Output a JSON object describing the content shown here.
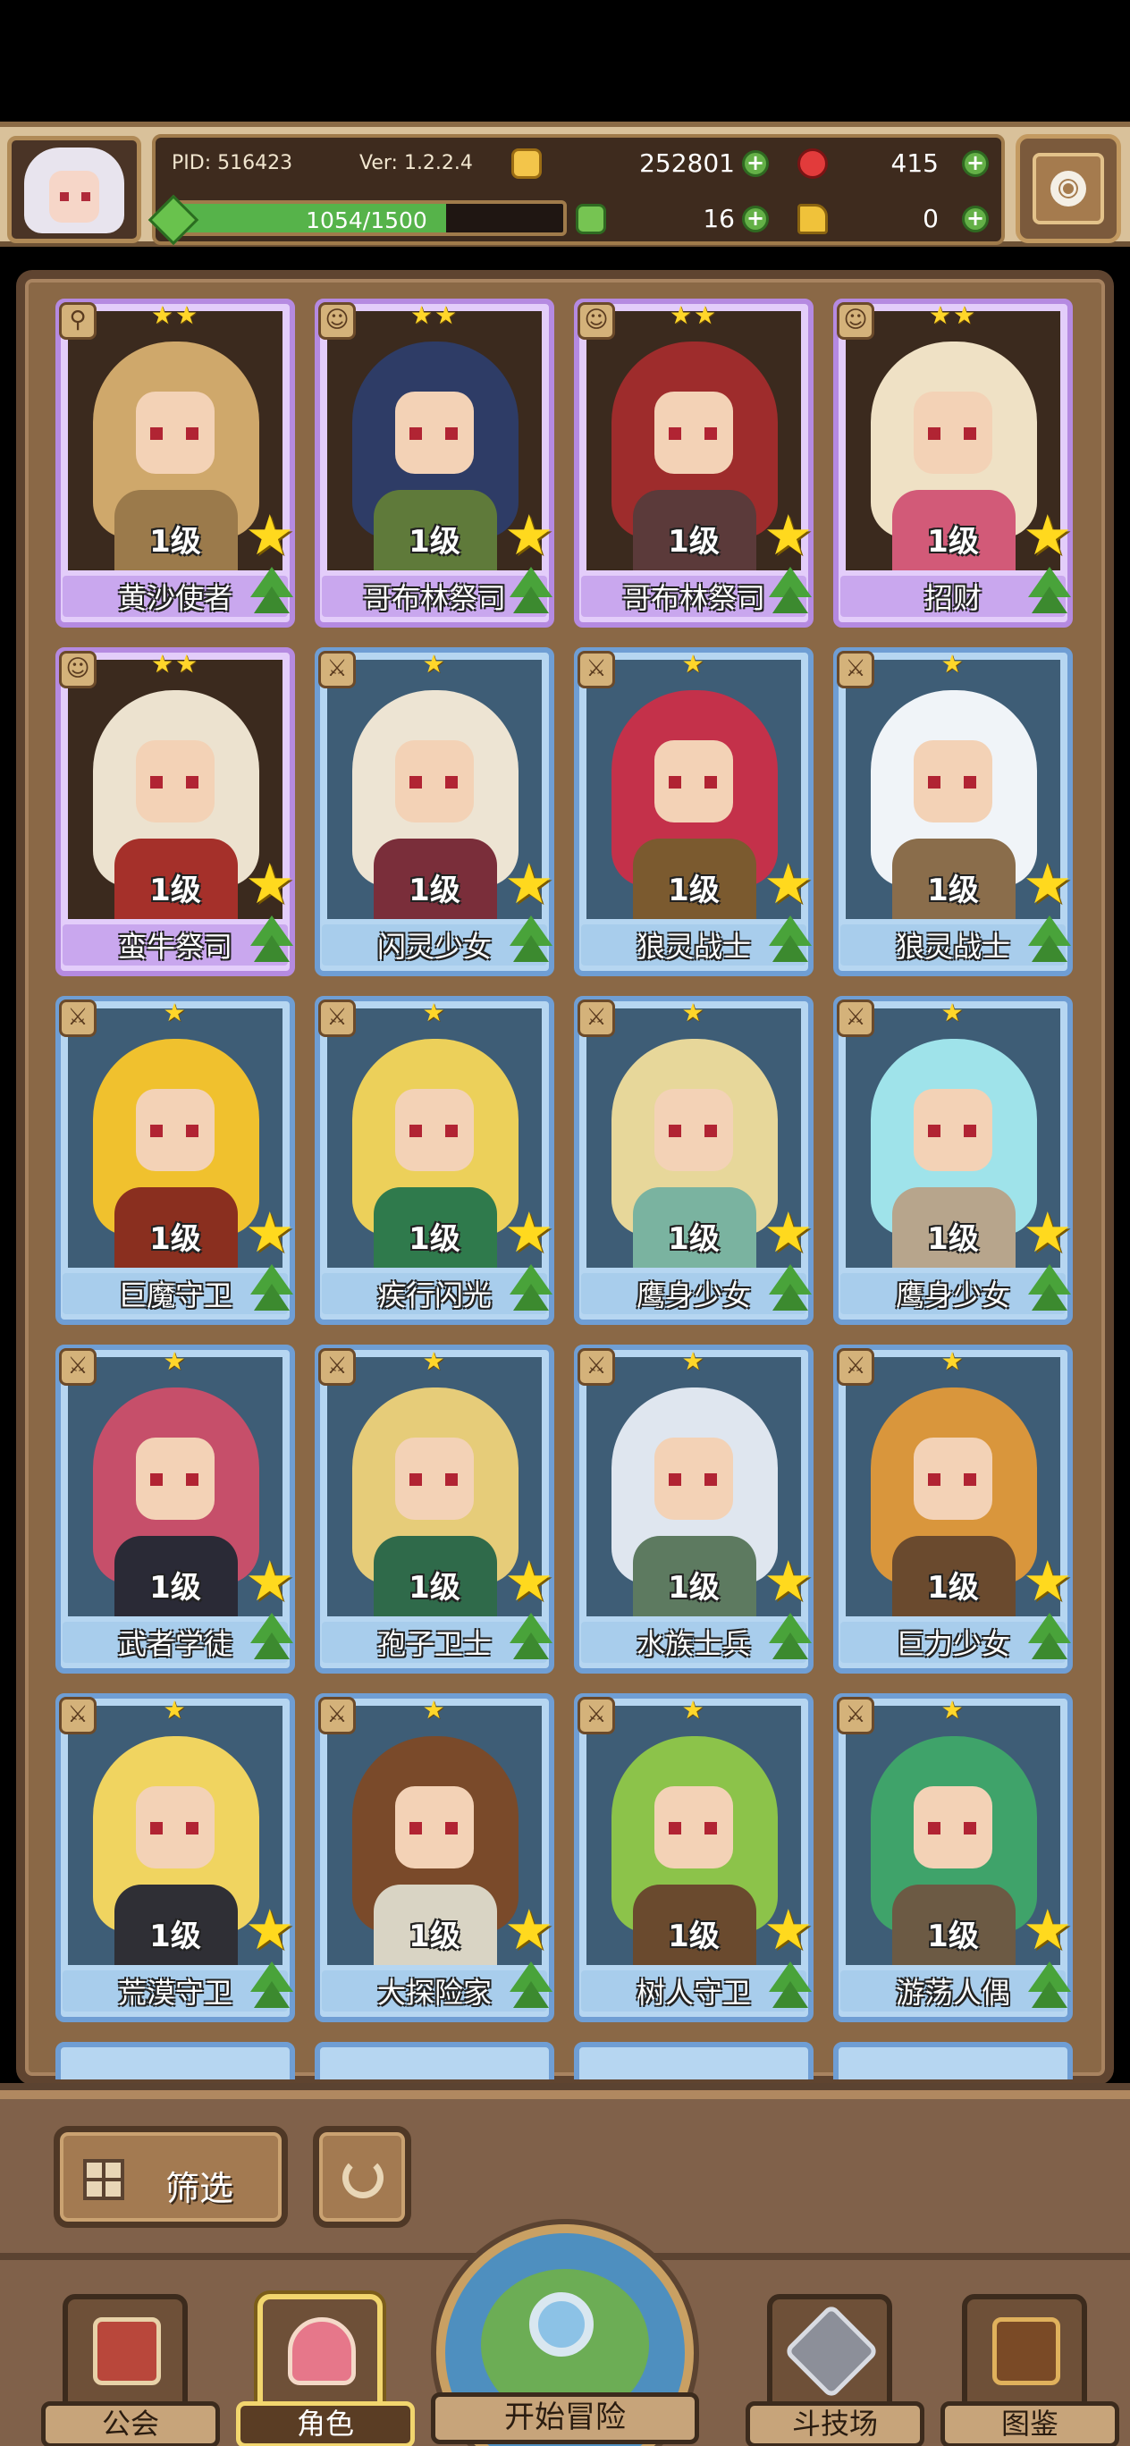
{
  "hud": {
    "pid": "PID: 516423",
    "version": "Ver: 1.2.2.4",
    "gold": "252801",
    "gems": "415",
    "exp_text": "1054/1500",
    "exp_progress": 0.703,
    "clover": "16",
    "keys": "0",
    "plus": "+"
  },
  "cards": [
    {
      "level": "1级",
      "name": "黄沙使者",
      "rarity": "purple",
      "stars": "★★",
      "class_icon": "staff-icon",
      "hair": "#cfa86b",
      "body": "#9b7a4b"
    },
    {
      "level": "1级",
      "name": "哥布林祭司",
      "rarity": "purple",
      "stars": "★★",
      "class_icon": "skull-icon",
      "hair": "#2e3c66",
      "body": "#5f7a3a"
    },
    {
      "level": "1级",
      "name": "哥布林祭司",
      "rarity": "purple",
      "stars": "★★",
      "class_icon": "skull-icon",
      "hair": "#9e2c2c",
      "body": "#5b3a3a"
    },
    {
      "level": "1级",
      "name": "招财",
      "rarity": "purple",
      "stars": "★★",
      "class_icon": "skull-icon",
      "hair": "#efe1c5",
      "body": "#d25a78"
    },
    {
      "level": "1级",
      "name": "蛮牛祭司",
      "rarity": "purple",
      "stars": "★★",
      "class_icon": "skull-icon",
      "hair": "#ece2cf",
      "body": "#a5302a"
    },
    {
      "level": "1级",
      "name": "闪灵少女",
      "rarity": "blue",
      "stars": "★",
      "class_icon": "sword-icon",
      "hair": "#ede4d3",
      "body": "#7a2e3a"
    },
    {
      "level": "1级",
      "name": "狼灵战士",
      "rarity": "blue",
      "stars": "★",
      "class_icon": "sword-icon",
      "hair": "#c4314a",
      "body": "#7b5a2f"
    },
    {
      "level": "1级",
      "name": "狼灵战士",
      "rarity": "blue",
      "stars": "★",
      "class_icon": "sword-icon",
      "hair": "#f0f4f8",
      "body": "#8a6d4b"
    },
    {
      "level": "1级",
      "name": "巨魔守卫",
      "rarity": "blue",
      "stars": "★",
      "class_icon": "sword-icon",
      "hair": "#f0c12e",
      "body": "#8a2f1f"
    },
    {
      "level": "1级",
      "name": "疾行闪光",
      "rarity": "blue",
      "stars": "★",
      "class_icon": "sword-icon",
      "hair": "#ecd05a",
      "body": "#2f7a4c"
    },
    {
      "level": "1级",
      "name": "鹰身少女",
      "rarity": "blue",
      "stars": "★",
      "class_icon": "sword-icon",
      "hair": "#e7d79a",
      "body": "#7ab3a0"
    },
    {
      "level": "1级",
      "name": "鹰身少女",
      "rarity": "blue",
      "stars": "★",
      "class_icon": "sword-icon",
      "hair": "#9fe3ea",
      "body": "#b7a58c"
    },
    {
      "level": "1级",
      "name": "武者学徒",
      "rarity": "blue",
      "stars": "★",
      "class_icon": "sword-icon",
      "hair": "#c64f6a",
      "body": "#2a2a36"
    },
    {
      "level": "1级",
      "name": "孢子卫士",
      "rarity": "blue",
      "stars": "★",
      "class_icon": "sword-icon",
      "hair": "#e6cc79",
      "body": "#2f6a4a"
    },
    {
      "level": "1级",
      "name": "水族士兵",
      "rarity": "blue",
      "stars": "★",
      "class_icon": "sword-icon",
      "hair": "#dfe6ef",
      "body": "#5d7a60"
    },
    {
      "level": "1级",
      "name": "巨力少女",
      "rarity": "blue",
      "stars": "★",
      "class_icon": "sword-icon",
      "hair": "#d9963c",
      "body": "#6a4a2e"
    },
    {
      "level": "1级",
      "name": "荒漠守卫",
      "rarity": "blue",
      "stars": "★",
      "class_icon": "sword-icon",
      "hair": "#f0d460",
      "body": "#2f2f35"
    },
    {
      "level": "1级",
      "name": "大探险家",
      "rarity": "blue",
      "stars": "★",
      "class_icon": "sword-icon",
      "hair": "#7a4a2a",
      "body": "#d9d4c4"
    },
    {
      "level": "1级",
      "name": "树人守卫",
      "rarity": "blue",
      "stars": "★",
      "class_icon": "sword-icon",
      "hair": "#8cc34a",
      "body": "#6a4a2e"
    },
    {
      "level": "1级",
      "name": "游荡人偶",
      "rarity": "blue",
      "stars": "★",
      "class_icon": "sword-icon",
      "hair": "#3fa36a",
      "body": "#6c5a44"
    }
  ],
  "filter": {
    "label": "筛选"
  },
  "nav": {
    "guild": "公会",
    "character": "角色",
    "adventure": "开始冒险",
    "arena": "斗技场",
    "codex": "图鉴"
  },
  "colors": {
    "exp": "#56b34a",
    "gold": "#f3c54a",
    "gem": "#e23b3b",
    "star": "#ffd91e",
    "purple": "#b58ae1",
    "blue": "#6f9ed4"
  }
}
